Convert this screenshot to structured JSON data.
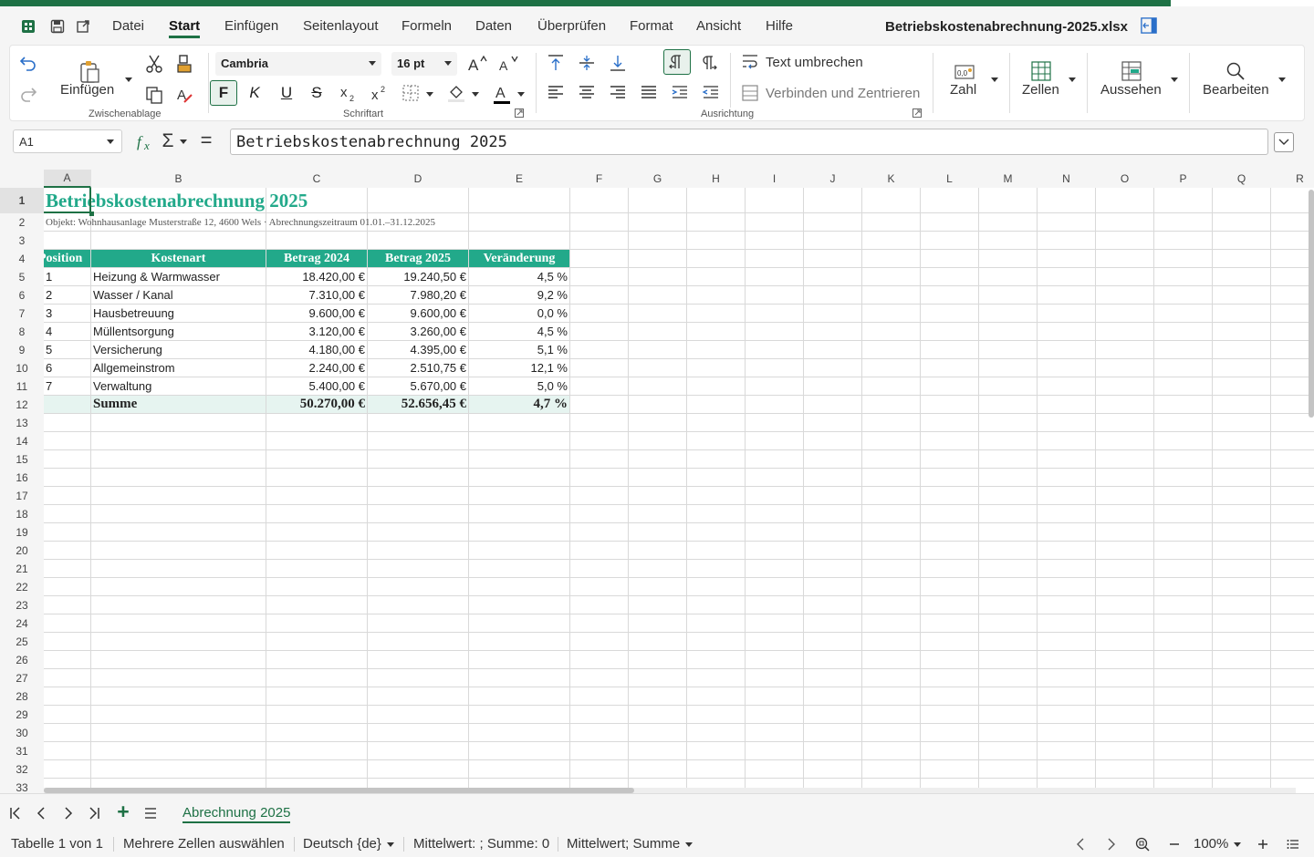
{
  "menubar": {
    "items": [
      "Datei",
      "Start",
      "Einfügen",
      "Seitenlayout",
      "Formeln",
      "Daten",
      "Überprüfen",
      "Format",
      "Ansicht",
      "Hilfe"
    ],
    "active": "Start",
    "doc_title": "Betriebskostenabrechnung-2025.xlsx"
  },
  "ribbon": {
    "paste_label": "Einfügen",
    "clipboard_group": "Zwischenablage",
    "font_name": "Cambria",
    "font_size": "16 pt",
    "bold_label": "F",
    "italic_label": "K",
    "underline_label": "U",
    "strike_label": "S",
    "font_group": "Schriftart",
    "wrap_text": "Text umbrechen",
    "merge_center": "Verbinden und Zentrieren",
    "alignment_group": "Ausrichtung",
    "number_label": "Zahl",
    "cells_label": "Zellen",
    "styles_label": "Aussehen",
    "edit_label": "Bearbeiten"
  },
  "formula_bar": {
    "name_box": "A1",
    "sum_symbol": "Σ",
    "equals_symbol": "=",
    "formula": "Betriebskostenabrechnung 2025"
  },
  "sheet": {
    "columns": [
      "A",
      "B",
      "C",
      "D",
      "E",
      "F",
      "G",
      "H",
      "I",
      "J",
      "K",
      "L",
      "M",
      "N",
      "O",
      "P",
      "Q",
      "R"
    ],
    "row_numbers": [
      1,
      2,
      3,
      4,
      5,
      6,
      7,
      8,
      9,
      10,
      11,
      12,
      13,
      14,
      15,
      16,
      17,
      18,
      19,
      20,
      21,
      22,
      23,
      24,
      25,
      26,
      27,
      28,
      29,
      30,
      31,
      32,
      33
    ],
    "title": "Betriebskostenabrechnung 2025",
    "subtitle": "Objekt: Wohnhausanlage Musterstraße 12, 4600 Wels  ·  Abrechnungszeitraum 01.01.–31.12.2025",
    "headers": [
      "Position",
      "Kostenart",
      "Betrag 2024",
      "Betrag 2025",
      "Veränderung"
    ],
    "rows": [
      {
        "pos": "1",
        "kostenart": "Heizung & Warmwasser",
        "b2024": "18.420,00 €",
        "b2025": "19.240,50 €",
        "change": "4,5 %"
      },
      {
        "pos": "2",
        "kostenart": "Wasser / Kanal",
        "b2024": "7.310,00 €",
        "b2025": "7.980,20 €",
        "change": "9,2 %"
      },
      {
        "pos": "3",
        "kostenart": "Hausbetreuung",
        "b2024": "9.600,00 €",
        "b2025": "9.600,00 €",
        "change": "0,0 %"
      },
      {
        "pos": "4",
        "kostenart": "Müllentsorgung",
        "b2024": "3.120,00 €",
        "b2025": "3.260,00 €",
        "change": "4,5 %"
      },
      {
        "pos": "5",
        "kostenart": "Versicherung",
        "b2024": "4.180,00 €",
        "b2025": "4.395,00 €",
        "change": "5,1 %"
      },
      {
        "pos": "6",
        "kostenart": "Allgemeinstrom",
        "b2024": "2.240,00 €",
        "b2025": "2.510,75 €",
        "change": "12,1 %"
      },
      {
        "pos": "7",
        "kostenart": "Verwaltung",
        "b2024": "5.400,00 €",
        "b2025": "5.670,00 €",
        "change": "5,0 %"
      }
    ],
    "sum": {
      "label": "Summe",
      "b2024": "50.270,00 €",
      "b2025": "52.656,45 €",
      "change": "4,7 %"
    }
  },
  "sheetbar": {
    "add_label": "+",
    "tab": "Abrechnung 2025"
  },
  "statusbar": {
    "sheet_info": "Tabelle 1 von 1",
    "selection_mode": "Mehrere Zellen auswählen",
    "language": "Deutsch {de}",
    "stats": "Mittelwert: ; Summe: 0",
    "stats_selector": "Mittelwert; Summe",
    "zoom": "100%"
  },
  "colors": {
    "accent": "#1e7145",
    "table_header": "#22a98a",
    "title_text": "#22a98a",
    "sum_row": "#e6f4f0"
  }
}
